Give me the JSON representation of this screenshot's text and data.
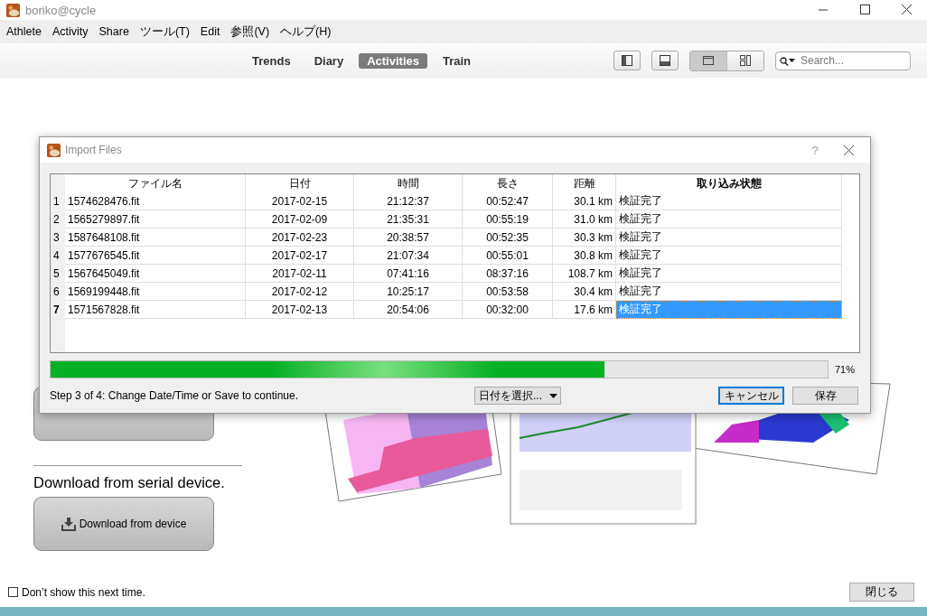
{
  "window": {
    "title": "boriko@cycle"
  },
  "menu": [
    "Athlete",
    "Activity",
    "Share",
    "ツール(T)",
    "Edit",
    "参照(V)",
    "ヘルプ(H)"
  ],
  "views": [
    {
      "label": "Trends",
      "selected": false
    },
    {
      "label": "Diary",
      "selected": false
    },
    {
      "label": "Activities",
      "selected": true
    },
    {
      "label": "Train",
      "selected": false
    }
  ],
  "view_modes": [
    {
      "selected": true
    },
    {
      "selected": false
    }
  ],
  "search": {
    "placeholder": "Search..."
  },
  "welcome": {
    "download_heading": "Download from serial device.",
    "download_button": "Download from device",
    "dont_show": {
      "label": "Don’t show this next time.",
      "checked": false
    },
    "close_button": "閉じる"
  },
  "dialog": {
    "title": "Import Files",
    "help": "?",
    "columns": [
      {
        "label": "ファイル名",
        "sorted": false
      },
      {
        "label": "日付",
        "sorted": false
      },
      {
        "label": "時間",
        "sorted": false
      },
      {
        "label": "長さ",
        "sorted": false
      },
      {
        "label": "距離",
        "sorted": false
      },
      {
        "label": "取り込み状態",
        "sorted": true
      }
    ],
    "rows": [
      {
        "number": "1",
        "cells": [
          "1574628476.fit",
          "2017-02-15",
          "21:12:37",
          "00:52:47",
          "30.1 km",
          "検証完了"
        ],
        "selected": false
      },
      {
        "number": "2",
        "cells": [
          "1565279897.fit",
          "2017-02-09",
          "21:35:31",
          "00:55:19",
          "31.0 km",
          "検証完了"
        ],
        "selected": false
      },
      {
        "number": "3",
        "cells": [
          "1587648108.fit",
          "2017-02-23",
          "20:38:57",
          "00:52:35",
          "30.3 km",
          "検証完了"
        ],
        "selected": false
      },
      {
        "number": "4",
        "cells": [
          "1577676545.fit",
          "2017-02-17",
          "21:07:34",
          "00:55:01",
          "30.8 km",
          "検証完了"
        ],
        "selected": false
      },
      {
        "number": "5",
        "cells": [
          "1567645049.fit",
          "2017-02-11",
          "07:41:16",
          "08:37:16",
          "108.7 km",
          "検証完了"
        ],
        "selected": false
      },
      {
        "number": "6",
        "cells": [
          "1569199448.fit",
          "2017-02-12",
          "10:25:17",
          "00:53:58",
          "30.4 km",
          "検証完了"
        ],
        "selected": false
      },
      {
        "number": "7",
        "cells": [
          "1571567828.fit",
          "2017-02-13",
          "20:54:06",
          "00:32:00",
          "17.6 km",
          "検証完了"
        ],
        "selected": true
      }
    ],
    "progress": {
      "level": 0.713,
      "reading": "71%"
    },
    "step_text": "Step 3 of 4: Change Date/Time or Save to continue.",
    "date_select": "日付を選択...",
    "buttons": [
      {
        "label": "キャンセル",
        "default": true
      },
      {
        "label": "保存",
        "default": false
      }
    ]
  }
}
